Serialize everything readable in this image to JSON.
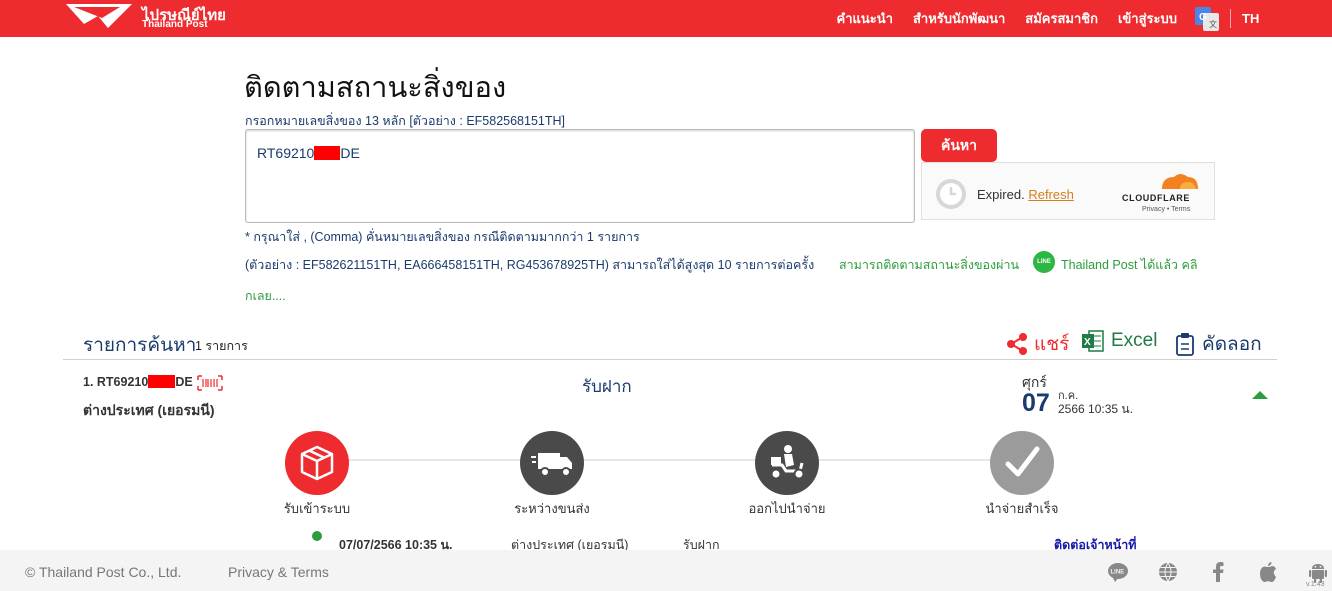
{
  "header": {
    "logo_th": "ไปรษณีย์ไทย",
    "logo_en": "Thailand Post",
    "nav": [
      "คำแนะนำ",
      "สำหรับนักพัฒนา",
      "สมัครสมาชิก",
      "เข้าสู่ระบบ"
    ],
    "lang": "TH",
    "translate_icon": "google-translate-icon"
  },
  "tracking": {
    "title": "ติดตามสถานะสิ่งของ",
    "instruction": "กรอกหมายเลขสิ่งของ 13 หลัก [ตัวอย่าง : EF582568151TH]",
    "input_prefix": "RT69210",
    "input_suffix": "DE",
    "search_label": "ค้นหา",
    "note1": "* กรุณาใส่ , (Comma) คั่นหมายเลขสิ่งของ กรณีติดตามมากกว่า 1 รายการ",
    "note2": "(ตัวอย่าง : EF582621151TH, EA666458151TH, RG453678925TH) สามารถใส่ได้สูงสุด 10 รายการต่อครั้ง",
    "line_promo_a": "สามารถติดตามสถานะสิ่งของผ่าน",
    "line_icon_text": "LINE",
    "line_promo_b": "Thailand Post ได้แล้ว คลิ",
    "line_promo_c": "กเลย...."
  },
  "captcha": {
    "expired": "Expired.",
    "refresh": "Refresh",
    "brand": "CLOUDFLARE",
    "links": "Privacy • Terms"
  },
  "results": {
    "title": "รายการค้นหา",
    "count": "1 รายการ",
    "share": "แชร์",
    "excel": "Excel",
    "copy": "คัดลอก"
  },
  "item": {
    "number_prefix": "1. RT69210",
    "number_suffix": "DE",
    "destination": "ต่างประเทศ (เยอรมนี)",
    "status": "รับฝาก",
    "day": "ศุกร์",
    "date_num": "07",
    "month": "ก.ค.",
    "year_time": "2566  10:35 น."
  },
  "steps": [
    {
      "label": "รับเข้าระบบ",
      "icon": "box-icon",
      "color": "#ee2b2e"
    },
    {
      "label": "ระหว่างขนส่ง",
      "icon": "truck-icon",
      "color": "#4a4a4a"
    },
    {
      "label": "ออกไปนำจ่าย",
      "icon": "scooter-icon",
      "color": "#4a4a4a"
    },
    {
      "label": "นำจ่ายสำเร็จ",
      "icon": "check-icon",
      "color": "#9b9b9b"
    }
  ],
  "history": {
    "date": "07/07/2566 10:35 น.",
    "location": "ต่างประเทศ (เยอรมนี)",
    "status": "รับฝาก",
    "contact": "ติดต่อเจ้าหน้าที่"
  },
  "footer": {
    "copyright": "© Thailand Post Co., Ltd.",
    "privacy": "Privacy & Terms",
    "icons": [
      "line-icon",
      "globe-icon",
      "facebook-icon",
      "apple-icon",
      "android-icon"
    ],
    "version": "v.1.43"
  }
}
